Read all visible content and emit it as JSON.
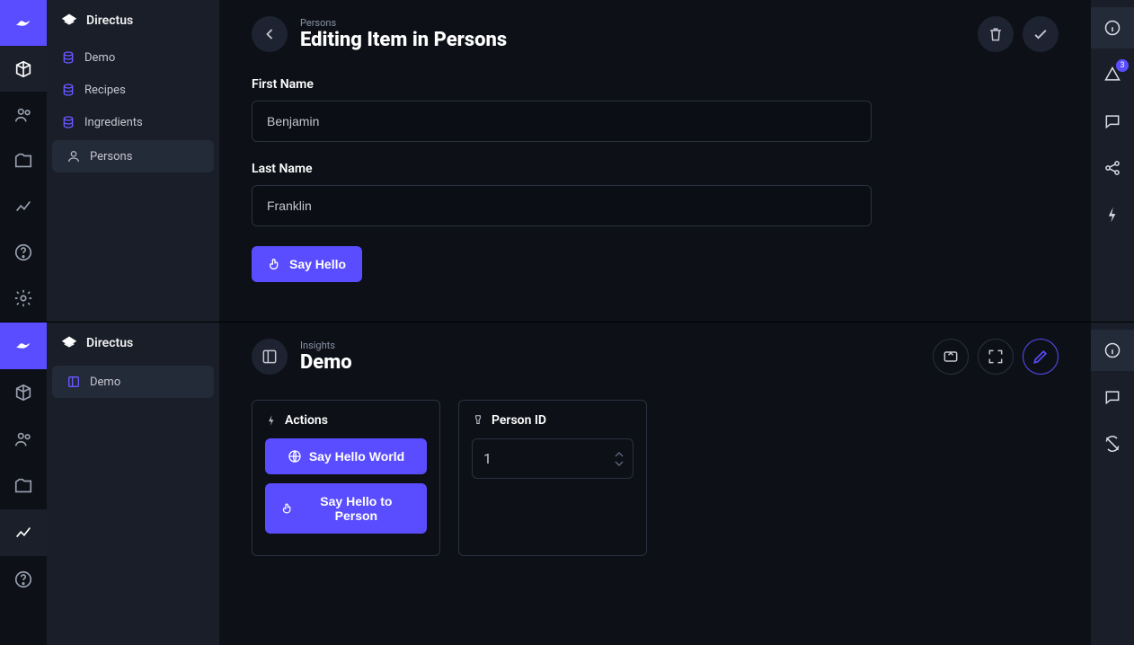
{
  "top": {
    "brand": "Directus",
    "sidebar_items": [
      {
        "label": "Demo"
      },
      {
        "label": "Recipes"
      },
      {
        "label": "Ingredients"
      },
      {
        "label": "Persons"
      }
    ],
    "breadcrumb": "Persons",
    "title": "Editing Item in Persons",
    "fields": {
      "first_name_label": "First Name",
      "first_name_value": "Benjamin",
      "last_name_label": "Last Name",
      "last_name_value": "Franklin"
    },
    "say_hello_btn": "Say Hello",
    "right_rail_badge": "3"
  },
  "bottom": {
    "brand": "Directus",
    "sidebar_items": [
      {
        "label": "Demo"
      }
    ],
    "breadcrumb": "Insights",
    "title": "Demo",
    "cards": {
      "actions_title": "Actions",
      "btn_world": "Say Hello World",
      "btn_person": "Say Hello to Person",
      "person_id_title": "Person ID",
      "person_id_value": "1"
    }
  }
}
